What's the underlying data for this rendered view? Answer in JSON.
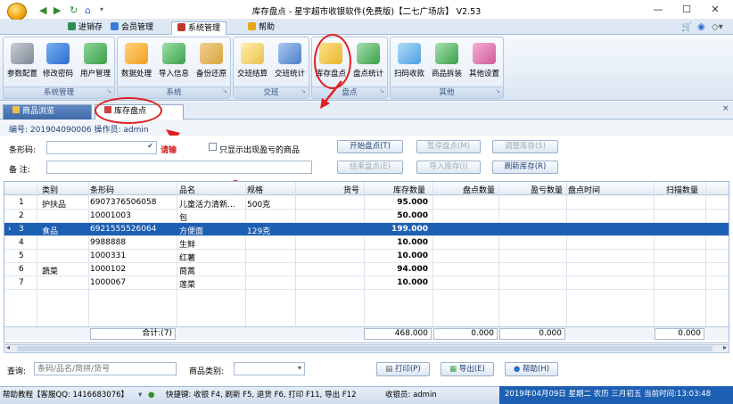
{
  "window": {
    "title": "库存盘点 - 星宇超市收银软件(免费版)【二七广场店】 V2.53",
    "minimize": "—",
    "maximize": "☐",
    "close": "✕"
  },
  "ribbon_tabs": [
    {
      "label": "进销存",
      "icon_color": "#2e8b57"
    },
    {
      "label": "会员管理",
      "icon_color": "#3a7bd5"
    },
    {
      "label": "系统管理",
      "icon_color": "#c0392b"
    },
    {
      "label": "帮助",
      "icon_color": "#e6a817"
    }
  ],
  "ribbon_groups": [
    {
      "title": "系统管理",
      "buttons": [
        {
          "label": "参数配置",
          "icon": "tools-icon",
          "color": "#8a8f99"
        },
        {
          "label": "修改密码",
          "icon": "key-icon",
          "color": "#2b6fd1"
        },
        {
          "label": "用户管理",
          "icon": "users-icon",
          "color": "#3aa04a"
        }
      ]
    },
    {
      "title": "系统",
      "buttons": [
        {
          "label": "数据处理",
          "icon": "data-process-icon",
          "color": "#f0a020"
        },
        {
          "label": "导入信息",
          "icon": "import-icon",
          "color": "#3aa04a"
        },
        {
          "label": "备份还原",
          "icon": "backup-icon",
          "color": "#d9a441"
        }
      ]
    },
    {
      "title": "交班",
      "buttons": [
        {
          "label": "交班结算",
          "icon": "handover-icon",
          "color": "#e9c14a"
        },
        {
          "label": "交班统计",
          "icon": "handover-stats-icon",
          "color": "#4a7fc8"
        }
      ]
    },
    {
      "title": "盘点",
      "buttons": [
        {
          "label": "库存盘点",
          "icon": "inventory-count-icon",
          "color": "#e9b52a"
        },
        {
          "label": "盘点统计",
          "icon": "count-stats-icon",
          "color": "#3aa04a"
        }
      ]
    },
    {
      "title": "其他",
      "buttons": [
        {
          "label": "扫码收款",
          "icon": "qr-pay-icon",
          "color": "#4aa0e0"
        },
        {
          "label": "商品拆装",
          "icon": "product-split-icon",
          "color": "#3aa04a"
        },
        {
          "label": "其他设置",
          "icon": "other-settings-icon",
          "color": "#d05a9a"
        }
      ]
    }
  ],
  "doc_tabs": [
    "商品浏览",
    "库存盘点"
  ],
  "info": {
    "text": "编号: 201904090006   操作员: admin"
  },
  "form": {
    "barcode_label": "条形码:",
    "barcode_hint": "请输",
    "only_diff_label": "只显示出现盈亏的商品",
    "remark_label": "备  注:",
    "buttons": {
      "start": "开始盘点(T)",
      "pause": "暂停盘点(M)",
      "adjust": "调整库存(S)",
      "end": "结束盘点(E)",
      "import": "导入库存(I)",
      "refresh": "刷新库存(R)"
    }
  },
  "grid": {
    "columns": [
      "类别",
      "条形码",
      "品名",
      "规格",
      "货号",
      "库存数量",
      "盘点数量",
      "盈亏数量",
      "盘点时间",
      "扫描数量"
    ],
    "rows": [
      {
        "no": "1",
        "category": "护扶品",
        "barcode": "6907376506058",
        "name": "儿童活力清新…",
        "spec": "500克",
        "sku": "",
        "stock": "95.000"
      },
      {
        "no": "2",
        "category": "",
        "barcode": "10001003",
        "name": "包",
        "spec": "",
        "sku": "",
        "stock": "50.000"
      },
      {
        "no": "3",
        "category": "食品",
        "barcode": "6921555526064",
        "name": "方便面",
        "spec": "129克",
        "sku": "",
        "stock": "199.000"
      },
      {
        "no": "4",
        "category": "",
        "barcode": "9988888",
        "name": "生鲜",
        "spec": "",
        "sku": "",
        "stock": "10.000"
      },
      {
        "no": "5",
        "category": "",
        "barcode": "1000331",
        "name": "红薯",
        "spec": "",
        "sku": "",
        "stock": "10.000"
      },
      {
        "no": "6",
        "category": "蔬菜",
        "barcode": "1000102",
        "name": "茼蒿",
        "spec": "",
        "sku": "",
        "stock": "94.000"
      },
      {
        "no": "7",
        "category": "",
        "barcode": "1000067",
        "name": "莲菜",
        "spec": "",
        "sku": "",
        "stock": "10.000"
      }
    ],
    "selected_row": 3,
    "summary": {
      "label": "合计:(7)",
      "stock_total": "468.000",
      "count_total": "0.000",
      "diff_total": "0.000",
      "scan_total": "0.000"
    }
  },
  "query": {
    "label": "查询:",
    "placeholder": "条码/品名/简拼/货号",
    "category_label": "商品类别:",
    "print": "打印(P)",
    "export": "导出(E)",
    "help": "帮助(H)"
  },
  "status": {
    "left": "帮助教程【客服QQ: 1416683076】",
    "shortcuts": "快捷键: 收银 F4, 刷新 F5, 退货 F6, 打印 F11, 导出 F12",
    "cashier": "收银员: admin",
    "datetime": "2019年04月09日 星期二 农历 三月初五 当前时间:13:03:48"
  }
}
